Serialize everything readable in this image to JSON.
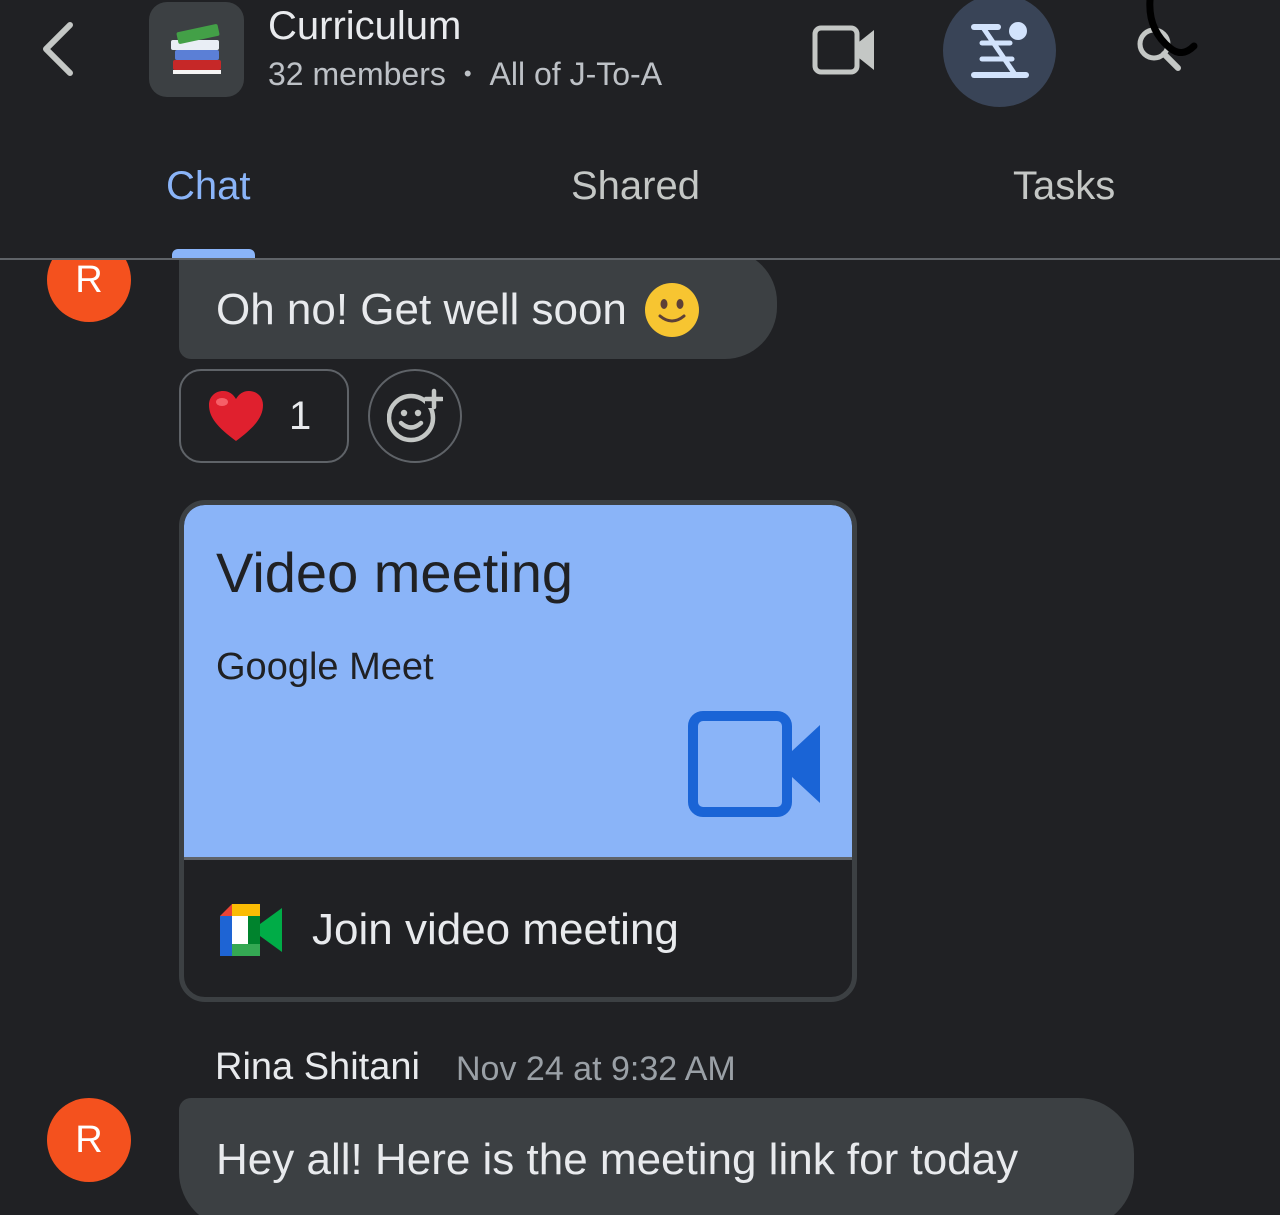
{
  "header": {
    "title": "Curriculum",
    "members": "32 members",
    "separator": "•",
    "subtitle_scope": "All of J-To-A",
    "icons": {
      "back": "chevron-left-icon",
      "space_avatar": "books-emoji",
      "video": "video-camera-icon",
      "threads": "threads-icon",
      "search": "search-icon"
    }
  },
  "tabs": [
    {
      "label": "Chat",
      "active": true
    },
    {
      "label": "Shared",
      "active": false
    },
    {
      "label": "Tasks",
      "active": false
    }
  ],
  "messages": [
    {
      "avatar_letter": "R",
      "text": "Oh no! Get well soon",
      "emoji": "slightly-smiling-face",
      "reactions": [
        {
          "emoji": "red-heart",
          "count": "1"
        }
      ]
    },
    {
      "card": {
        "title": "Video meeting",
        "subtitle": "Google Meet",
        "action": "Join video meeting"
      }
    },
    {
      "avatar_letter": "R",
      "sender": "Rina Shitani",
      "timestamp": "Nov 24 at 9:32 AM",
      "text": "Hey all! Here is the meeting link for today"
    }
  ],
  "colors": {
    "background": "#202124",
    "accent": "#8ab4f8",
    "avatar": "#f4511e",
    "bubble": "#3c4043",
    "threads_button": "#394457"
  }
}
